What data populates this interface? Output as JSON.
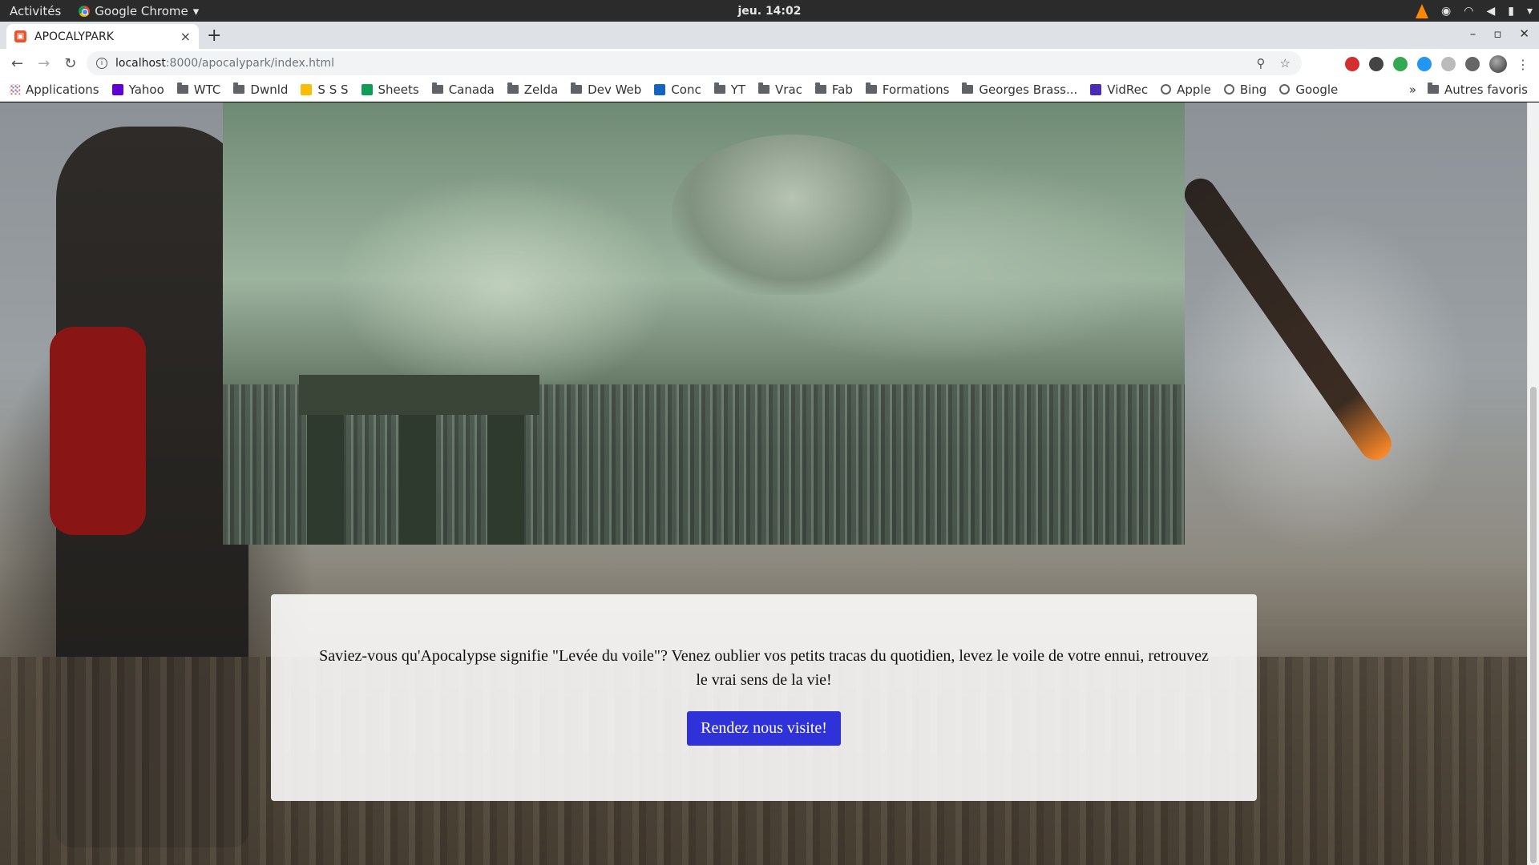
{
  "system_bar": {
    "activities": "Activités",
    "app_name": "Google Chrome",
    "clock": "jeu. 14:02"
  },
  "tab": {
    "title": "APOCALYPARK",
    "new_tab": "+",
    "close": "×"
  },
  "window_controls": {
    "minimize": "–",
    "restore": "▫",
    "close": "✕"
  },
  "address_bar": {
    "host": "localhost",
    "path": ":8000/apocalypark/index.html"
  },
  "bookmarks": [
    {
      "label": "Applications",
      "icon": "apps-grid-icon"
    },
    {
      "label": "Yahoo",
      "icon": "yahoo-icon"
    },
    {
      "label": "WTC",
      "icon": "folder-icon"
    },
    {
      "label": "Dwnld",
      "icon": "folder-icon"
    },
    {
      "label": "S S S",
      "icon": "drive-icon"
    },
    {
      "label": "Sheets",
      "icon": "sheets-icon"
    },
    {
      "label": "Canada",
      "icon": "folder-icon"
    },
    {
      "label": "Zelda",
      "icon": "folder-icon"
    },
    {
      "label": "Dev Web",
      "icon": "folder-icon"
    },
    {
      "label": "Conc",
      "icon": "conc-icon"
    },
    {
      "label": "YT",
      "icon": "folder-icon"
    },
    {
      "label": "Vrac",
      "icon": "folder-icon"
    },
    {
      "label": "Fab",
      "icon": "folder-icon"
    },
    {
      "label": "Formations",
      "icon": "folder-icon"
    },
    {
      "label": "Georges Brass...",
      "icon": "folder-icon"
    },
    {
      "label": "VidRec",
      "icon": "vidrec-icon"
    },
    {
      "label": "Apple",
      "icon": "globe-icon"
    },
    {
      "label": "Bing",
      "icon": "globe-icon"
    },
    {
      "label": "Google",
      "icon": "globe-icon"
    }
  ],
  "bookmarks_overflow": "»",
  "other_bookmarks": "Autres favoris",
  "page": {
    "intro_text": "Saviez-vous qu'Apocalypse signifie \"Levée du voile\"? Venez oublier vos petits tracas du quotidien, levez le voile de votre ennui, retrouvez le vrai sens de la vie!",
    "cta_label": "Rendez nous visite!"
  }
}
